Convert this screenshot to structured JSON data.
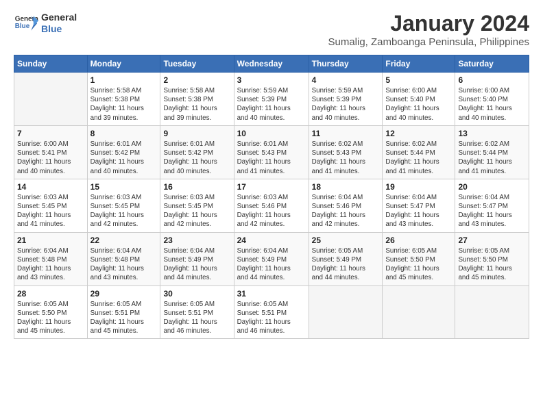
{
  "header": {
    "logo_line1": "General",
    "logo_line2": "Blue",
    "main_title": "January 2024",
    "subtitle": "Sumalig, Zamboanga Peninsula, Philippines"
  },
  "days_of_week": [
    "Sunday",
    "Monday",
    "Tuesday",
    "Wednesday",
    "Thursday",
    "Friday",
    "Saturday"
  ],
  "weeks": [
    [
      {
        "num": "",
        "info": ""
      },
      {
        "num": "1",
        "info": "Sunrise: 5:58 AM\nSunset: 5:38 PM\nDaylight: 11 hours\nand 39 minutes."
      },
      {
        "num": "2",
        "info": "Sunrise: 5:58 AM\nSunset: 5:38 PM\nDaylight: 11 hours\nand 39 minutes."
      },
      {
        "num": "3",
        "info": "Sunrise: 5:59 AM\nSunset: 5:39 PM\nDaylight: 11 hours\nand 40 minutes."
      },
      {
        "num": "4",
        "info": "Sunrise: 5:59 AM\nSunset: 5:39 PM\nDaylight: 11 hours\nand 40 minutes."
      },
      {
        "num": "5",
        "info": "Sunrise: 6:00 AM\nSunset: 5:40 PM\nDaylight: 11 hours\nand 40 minutes."
      },
      {
        "num": "6",
        "info": "Sunrise: 6:00 AM\nSunset: 5:40 PM\nDaylight: 11 hours\nand 40 minutes."
      }
    ],
    [
      {
        "num": "7",
        "info": "Sunrise: 6:00 AM\nSunset: 5:41 PM\nDaylight: 11 hours\nand 40 minutes."
      },
      {
        "num": "8",
        "info": "Sunrise: 6:01 AM\nSunset: 5:42 PM\nDaylight: 11 hours\nand 40 minutes."
      },
      {
        "num": "9",
        "info": "Sunrise: 6:01 AM\nSunset: 5:42 PM\nDaylight: 11 hours\nand 40 minutes."
      },
      {
        "num": "10",
        "info": "Sunrise: 6:01 AM\nSunset: 5:43 PM\nDaylight: 11 hours\nand 41 minutes."
      },
      {
        "num": "11",
        "info": "Sunrise: 6:02 AM\nSunset: 5:43 PM\nDaylight: 11 hours\nand 41 minutes."
      },
      {
        "num": "12",
        "info": "Sunrise: 6:02 AM\nSunset: 5:44 PM\nDaylight: 11 hours\nand 41 minutes."
      },
      {
        "num": "13",
        "info": "Sunrise: 6:02 AM\nSunset: 5:44 PM\nDaylight: 11 hours\nand 41 minutes."
      }
    ],
    [
      {
        "num": "14",
        "info": "Sunrise: 6:03 AM\nSunset: 5:45 PM\nDaylight: 11 hours\nand 41 minutes."
      },
      {
        "num": "15",
        "info": "Sunrise: 6:03 AM\nSunset: 5:45 PM\nDaylight: 11 hours\nand 42 minutes."
      },
      {
        "num": "16",
        "info": "Sunrise: 6:03 AM\nSunset: 5:45 PM\nDaylight: 11 hours\nand 42 minutes."
      },
      {
        "num": "17",
        "info": "Sunrise: 6:03 AM\nSunset: 5:46 PM\nDaylight: 11 hours\nand 42 minutes."
      },
      {
        "num": "18",
        "info": "Sunrise: 6:04 AM\nSunset: 5:46 PM\nDaylight: 11 hours\nand 42 minutes."
      },
      {
        "num": "19",
        "info": "Sunrise: 6:04 AM\nSunset: 5:47 PM\nDaylight: 11 hours\nand 43 minutes."
      },
      {
        "num": "20",
        "info": "Sunrise: 6:04 AM\nSunset: 5:47 PM\nDaylight: 11 hours\nand 43 minutes."
      }
    ],
    [
      {
        "num": "21",
        "info": "Sunrise: 6:04 AM\nSunset: 5:48 PM\nDaylight: 11 hours\nand 43 minutes."
      },
      {
        "num": "22",
        "info": "Sunrise: 6:04 AM\nSunset: 5:48 PM\nDaylight: 11 hours\nand 43 minutes."
      },
      {
        "num": "23",
        "info": "Sunrise: 6:04 AM\nSunset: 5:49 PM\nDaylight: 11 hours\nand 44 minutes."
      },
      {
        "num": "24",
        "info": "Sunrise: 6:04 AM\nSunset: 5:49 PM\nDaylight: 11 hours\nand 44 minutes."
      },
      {
        "num": "25",
        "info": "Sunrise: 6:05 AM\nSunset: 5:49 PM\nDaylight: 11 hours\nand 44 minutes."
      },
      {
        "num": "26",
        "info": "Sunrise: 6:05 AM\nSunset: 5:50 PM\nDaylight: 11 hours\nand 45 minutes."
      },
      {
        "num": "27",
        "info": "Sunrise: 6:05 AM\nSunset: 5:50 PM\nDaylight: 11 hours\nand 45 minutes."
      }
    ],
    [
      {
        "num": "28",
        "info": "Sunrise: 6:05 AM\nSunset: 5:50 PM\nDaylight: 11 hours\nand 45 minutes."
      },
      {
        "num": "29",
        "info": "Sunrise: 6:05 AM\nSunset: 5:51 PM\nDaylight: 11 hours\nand 45 minutes."
      },
      {
        "num": "30",
        "info": "Sunrise: 6:05 AM\nSunset: 5:51 PM\nDaylight: 11 hours\nand 46 minutes."
      },
      {
        "num": "31",
        "info": "Sunrise: 6:05 AM\nSunset: 5:51 PM\nDaylight: 11 hours\nand 46 minutes."
      },
      {
        "num": "",
        "info": ""
      },
      {
        "num": "",
        "info": ""
      },
      {
        "num": "",
        "info": ""
      }
    ]
  ]
}
